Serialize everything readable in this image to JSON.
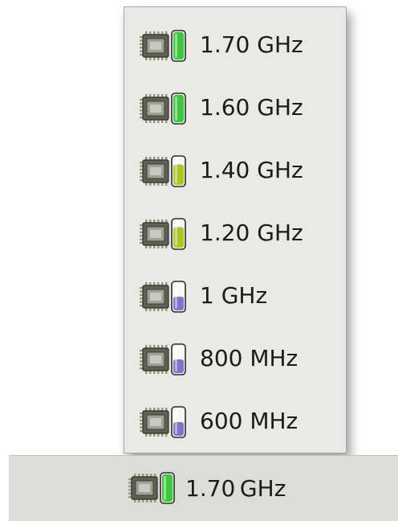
{
  "menu": {
    "items": [
      {
        "label": "1.70 GHz",
        "icon": "cpu-frequency-icon",
        "level": 1.0,
        "color": "#3cc83c"
      },
      {
        "label": "1.60 GHz",
        "icon": "cpu-frequency-icon",
        "level": 1.0,
        "color": "#3cc83c"
      },
      {
        "label": "1.40 GHz",
        "icon": "cpu-frequency-icon",
        "level": 0.75,
        "color": "#a8c81e"
      },
      {
        "label": "1.20 GHz",
        "icon": "cpu-frequency-icon",
        "level": 0.75,
        "color": "#a8c81e"
      },
      {
        "label": "1 GHz",
        "icon": "cpu-frequency-icon",
        "level": 0.5,
        "color": "#7b76cc"
      },
      {
        "label": "800 MHz",
        "icon": "cpu-frequency-icon",
        "level": 0.5,
        "color": "#7b76cc"
      },
      {
        "label": "600 MHz",
        "icon": "cpu-frequency-icon",
        "level": 0.5,
        "color": "#7b76cc"
      }
    ]
  },
  "panel": {
    "current_label": "1.70 GHz",
    "icon": "cpu-frequency-icon",
    "level": 1.0,
    "color": "#3cc83c"
  }
}
